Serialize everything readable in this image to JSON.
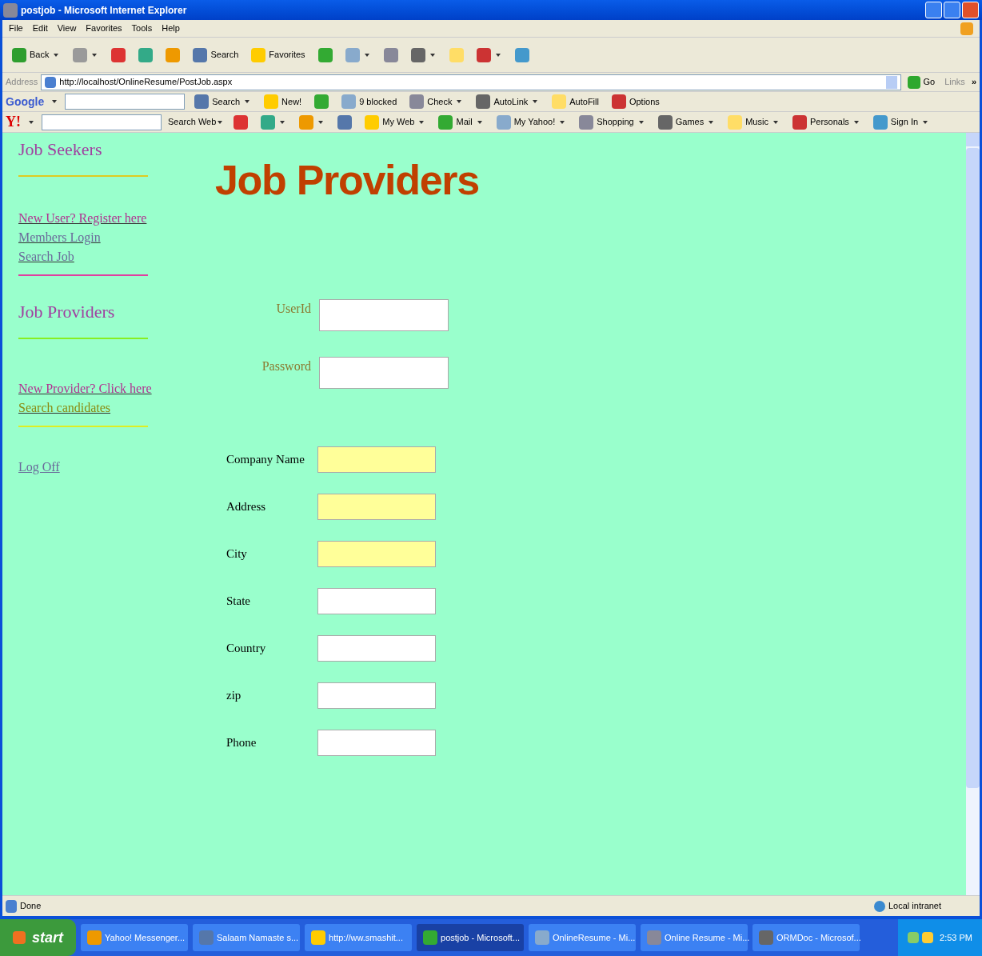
{
  "window": {
    "title": "postjob - Microsoft Internet Explorer"
  },
  "menu": [
    "File",
    "Edit",
    "View",
    "Favorites",
    "Tools",
    "Help"
  ],
  "toolbar": [
    {
      "label": "Back",
      "dropdown": true
    },
    {
      "dropdown": true
    },
    {
      "dropdown": false
    },
    {
      "dropdown": false
    },
    {
      "dropdown": false
    },
    {
      "label": "Search",
      "dropdown": false
    },
    {
      "label": "Favorites",
      "dropdown": false
    },
    {
      "dropdown": false
    },
    {
      "dropdown": true
    },
    {
      "dropdown": false
    },
    {
      "dropdown": true
    },
    {
      "dropdown": false
    },
    {
      "dropdown": true
    },
    {
      "dropdown": false
    }
  ],
  "address": {
    "label": "Address",
    "url": "http://localhost/OnlineResume/PostJob.aspx",
    "go": "Go",
    "links": "Links",
    "more": "»"
  },
  "google_toolbar": {
    "logo": "Google",
    "items": [
      {
        "label": "Search",
        "dropdown": true
      },
      {
        "label": "New!",
        "dropdown": false
      },
      {
        "dropdown": false
      },
      {
        "label": "9 blocked",
        "dropdown": false
      },
      {
        "label": "Check",
        "dropdown": true
      },
      {
        "label": "AutoLink",
        "dropdown": true
      },
      {
        "label": "AutoFill",
        "dropdown": false
      },
      {
        "label": "Options",
        "dropdown": false
      }
    ]
  },
  "yahoo_toolbar": {
    "logo": "Y!",
    "search_button": "Search Web",
    "items": [
      {
        "dropdown": false
      },
      {
        "dropdown": true
      },
      {
        "dropdown": true
      },
      {
        "dropdown": false
      },
      {
        "label": "My Web",
        "dropdown": true
      },
      {
        "label": "Mail",
        "dropdown": true
      },
      {
        "label": "My Yahoo!",
        "dropdown": true
      },
      {
        "label": "Shopping",
        "dropdown": true
      },
      {
        "label": "Games",
        "dropdown": true
      },
      {
        "label": "Music",
        "dropdown": true
      },
      {
        "label": "Personals",
        "dropdown": true
      },
      {
        "label": "Sign In",
        "dropdown": true
      }
    ]
  },
  "sidebar": [
    {
      "title": "Job Seekers",
      "links": [
        {
          "label": "New User? Register here",
          "visited": false
        },
        {
          "label": "Members Login",
          "visited": true
        },
        {
          "label": "Search Job",
          "visited": true
        }
      ]
    },
    {
      "title": "Job Providers",
      "links": [
        {
          "label": "New Provider? Click here",
          "visited": false
        },
        {
          "label": "Search candidates",
          "visited": true
        }
      ]
    }
  ],
  "logoff": {
    "label": "Log Off",
    "visited": true
  },
  "heading": "Job Providers",
  "login_fields": [
    {
      "label": "UserId"
    },
    {
      "label": "Password"
    }
  ],
  "company_fields": [
    {
      "label": "Company Name",
      "highlighted": true
    },
    {
      "label": "Address",
      "highlighted": true
    },
    {
      "label": "City",
      "highlighted": true
    },
    {
      "label": "State",
      "highlighted": false
    },
    {
      "label": "Country",
      "highlighted": false
    },
    {
      "label": "zip",
      "highlighted": false
    },
    {
      "label": "Phone",
      "highlighted": false
    }
  ],
  "status_bar": {
    "text": "Done",
    "zone": "Local intranet"
  },
  "taskbar": {
    "start": "start",
    "items": [
      {
        "label": "Yahoo! Messenger...",
        "selected": false
      },
      {
        "label": "Salaam Namaste s...",
        "selected": false
      },
      {
        "label": "http://ww.smashit...",
        "selected": false
      },
      {
        "label": "postjob - Microsoft...",
        "selected": true
      },
      {
        "label": "OnlineResume - Mi...",
        "selected": false
      },
      {
        "label": "Online Resume - Mi...",
        "selected": false
      },
      {
        "label": "ORMDoc - Microsof...",
        "selected": false
      }
    ],
    "clock": "2:53 PM"
  }
}
